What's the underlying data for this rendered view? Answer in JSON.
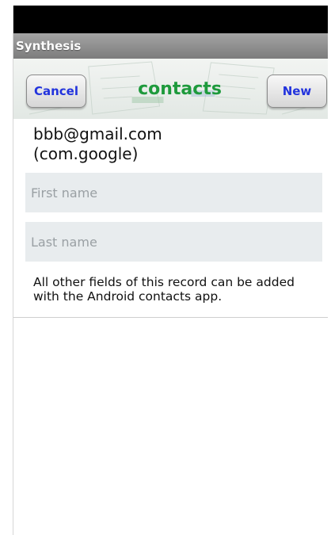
{
  "app": {
    "title": "Synthesis"
  },
  "header": {
    "title": "contacts",
    "cancel_label": "Cancel",
    "new_label": "New"
  },
  "account": {
    "email": "bbb@gmail.com",
    "type": "(com.google)"
  },
  "form": {
    "first_name_placeholder": "First name",
    "last_name_placeholder": "Last name",
    "note": "All other fields of this record can be added with the Android contacts app."
  },
  "colors": {
    "title_green": "#1e9a3c",
    "button_text_blue": "#2233dd",
    "field_bg": "#e8ecee"
  }
}
